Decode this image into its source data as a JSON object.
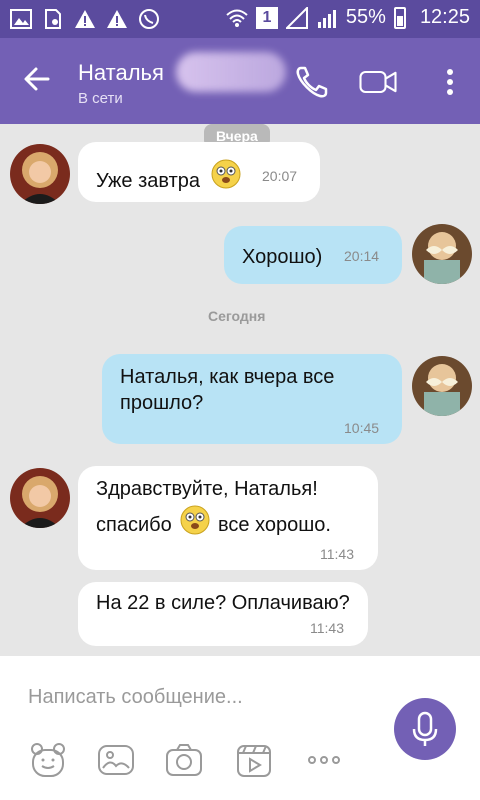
{
  "status_bar": {
    "battery": "55%",
    "time": "12:25",
    "sim": "1"
  },
  "header": {
    "contact_name": "Наталья",
    "status": "В сети"
  },
  "chat": {
    "date_yesterday": "Вчера",
    "date_today": "Сегодня",
    "messages": [
      {
        "direction": "in",
        "text": "Уже завтра",
        "time": "20:07"
      },
      {
        "direction": "out",
        "text": "Хорошо)",
        "time": "20:14"
      },
      {
        "direction": "out",
        "line1": "Наталья,  как вчера все",
        "line2": "прошло?",
        "time": "10:45"
      },
      {
        "direction": "in",
        "line1": "Здравствуйте, Наталья!",
        "line2a": "спасибо",
        "line2b": "все хорошо.",
        "time": "11:43"
      },
      {
        "direction": "in",
        "text": "На 22 в силе? Оплачиваю?",
        "time": "11:43"
      }
    ]
  },
  "composer": {
    "placeholder": "Написать сообщение..."
  },
  "icons": {
    "back": "back-arrow-icon",
    "call": "phone-icon",
    "video": "video-camera-icon",
    "menu": "more-vertical-icon",
    "mic": "microphone-icon"
  },
  "colors": {
    "header": "#7360b5",
    "status_bar": "#5b4b9e",
    "bubble_out": "#b8e3f5",
    "bubble_in": "#ffffff"
  }
}
